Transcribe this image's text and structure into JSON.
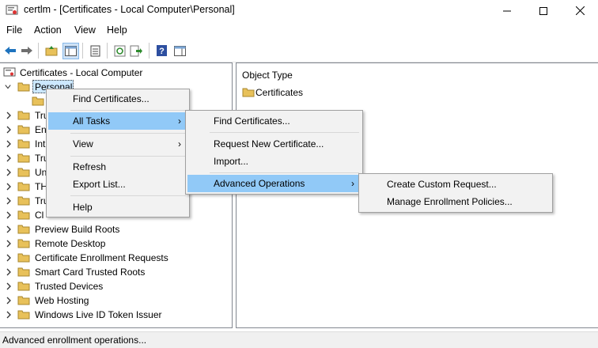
{
  "window": {
    "title": "certlm - [Certificates - Local Computer\\Personal]"
  },
  "menubar": {
    "file": "File",
    "action": "Action",
    "view": "View",
    "help": "Help"
  },
  "toolbar": {
    "icons": [
      "back-arrow-icon",
      "forward-arrow-icon",
      "up-folder-icon",
      "show-hide-tree-icon",
      "properties-icon",
      "refresh-icon",
      "export-list-icon",
      "help-icon",
      "show-action-pane-icon"
    ]
  },
  "tree": {
    "root": "Certificates - Local Computer",
    "selected": "Personal",
    "items": [
      "Personal",
      "Certificates",
      "Tru",
      "En",
      "Int",
      "Tru",
      "Un",
      "TH",
      "Tru",
      "Cl",
      "Preview Build Roots",
      "Remote Desktop",
      "Certificate Enrollment Requests",
      "Smart Card Trusted Roots",
      "Trusted Devices",
      "Web Hosting",
      "Windows Live ID Token Issuer"
    ]
  },
  "details": {
    "column_header": "Object Type",
    "rows": [
      "Certificates"
    ]
  },
  "context_menu": {
    "items": [
      "Find Certificates...",
      "All Tasks",
      "View",
      "Refresh",
      "Export List...",
      "Help"
    ],
    "highlighted": "All Tasks"
  },
  "all_tasks_menu": {
    "items": [
      "Find Certificates...",
      "Request New Certificate...",
      "Import...",
      "Advanced Operations"
    ],
    "highlighted": "Advanced Operations"
  },
  "advanced_menu": {
    "items": [
      "Create Custom Request...",
      "Manage Enrollment Policies..."
    ]
  },
  "statusbar": {
    "text": "Advanced enrollment operations..."
  },
  "colors": {
    "highlight": "#91c9f7",
    "selection": "#cce8ff",
    "folder": "#e8c15a"
  }
}
